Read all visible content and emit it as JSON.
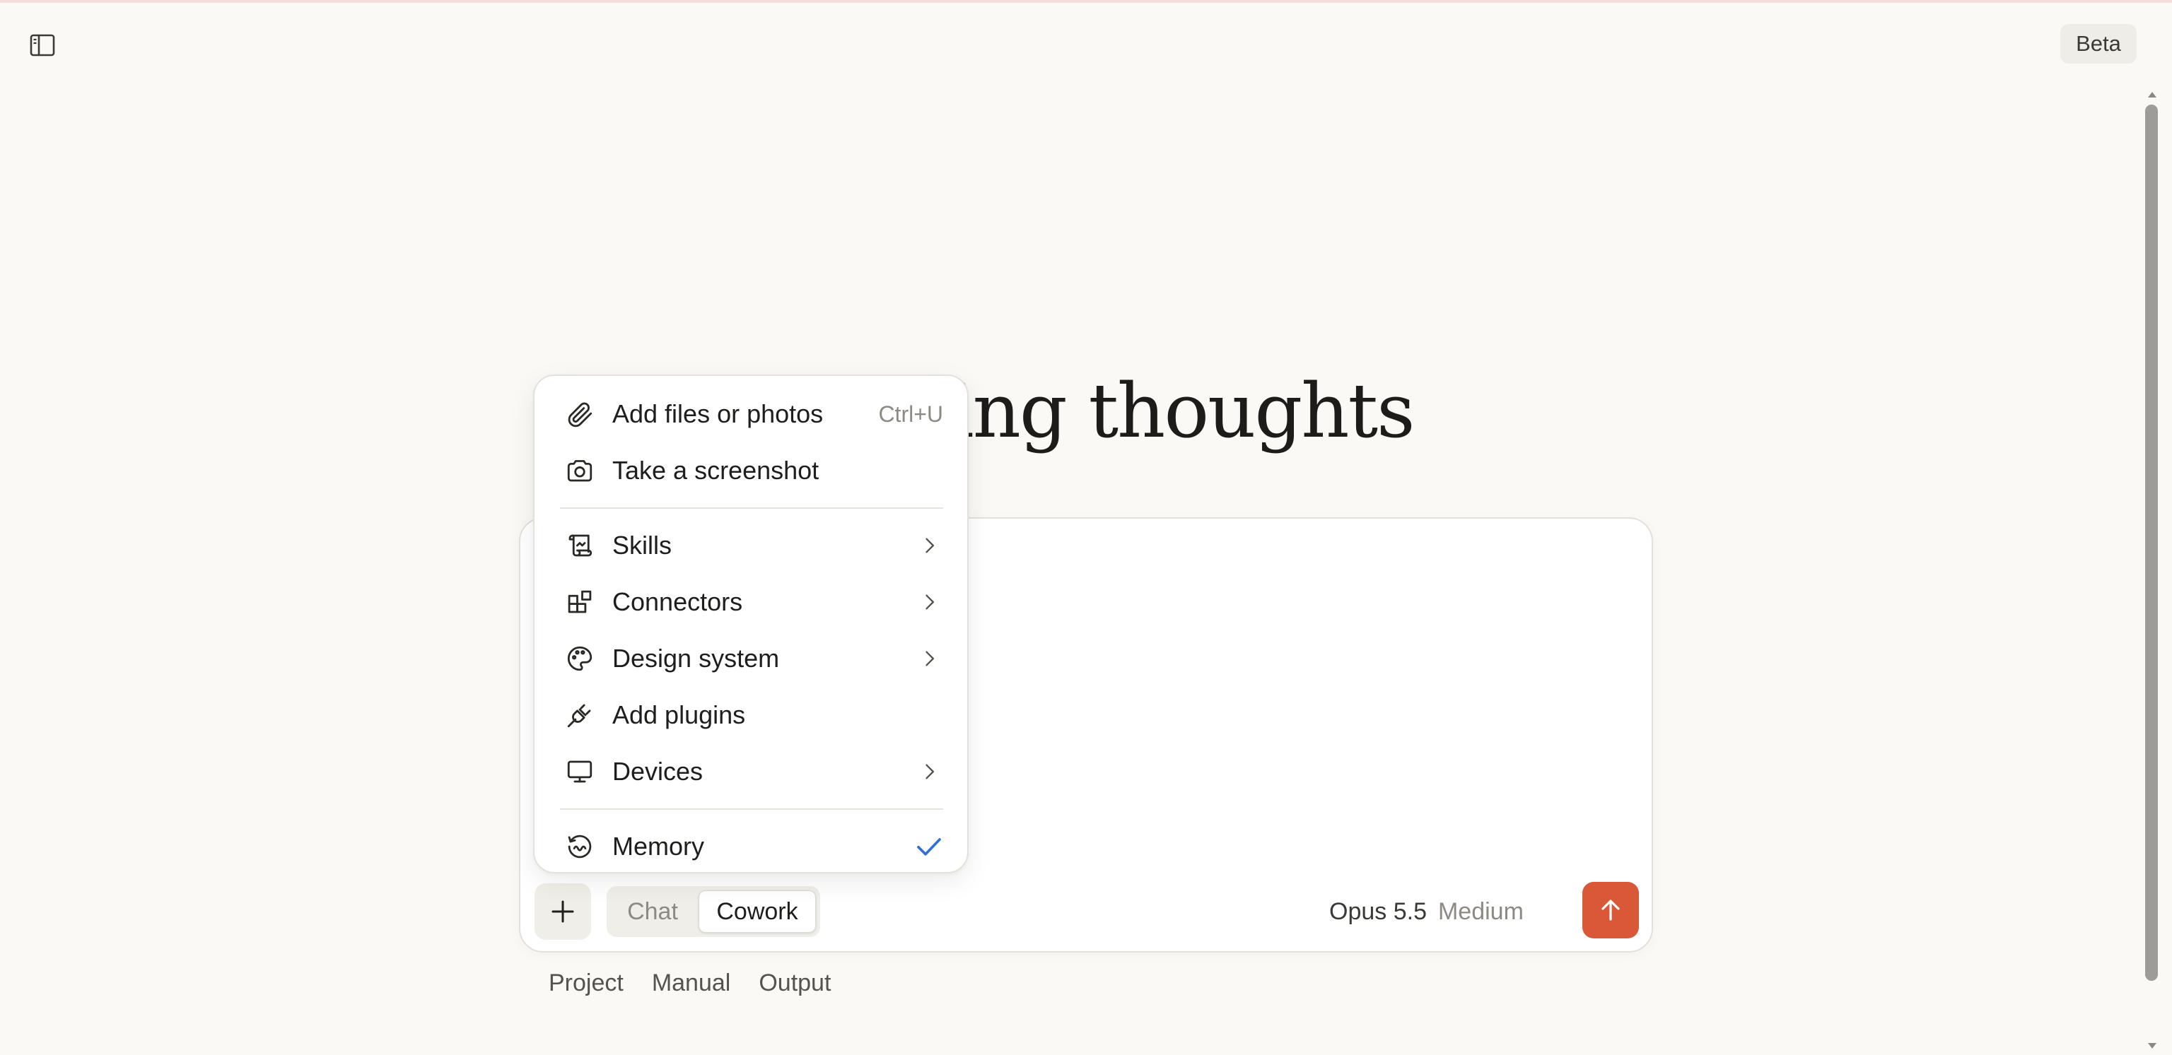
{
  "topbar": {
    "beta_label": "Beta"
  },
  "greeting": "Morning thoughts",
  "composer": {
    "modes": {
      "chat": "Chat",
      "cowork": "Cowork"
    },
    "active_mode": "Cowork",
    "model": {
      "name": "Opus 5.5",
      "effort": "Medium"
    }
  },
  "footer": {
    "project": "Project",
    "manual": "Manual",
    "output": "Output"
  },
  "menu": {
    "add_files": {
      "label": "Add files or photos",
      "shortcut": "Ctrl+U",
      "icon": "paperclip-icon"
    },
    "screenshot": {
      "label": "Take a screenshot",
      "icon": "camera-icon"
    },
    "skills": {
      "label": "Skills",
      "icon": "scroll-icon"
    },
    "connectors": {
      "label": "Connectors",
      "icon": "blocks-icon"
    },
    "design_system": {
      "label": "Design system",
      "icon": "palette-icon"
    },
    "plugins": {
      "label": "Add plugins",
      "icon": "plug-icon"
    },
    "devices": {
      "label": "Devices",
      "icon": "monitor-icon"
    },
    "memory": {
      "label": "Memory",
      "icon": "memory-icon",
      "checked": true
    }
  },
  "colors": {
    "accent": "#d95838",
    "check": "#2f6fd6",
    "background": "#faf9f6"
  }
}
